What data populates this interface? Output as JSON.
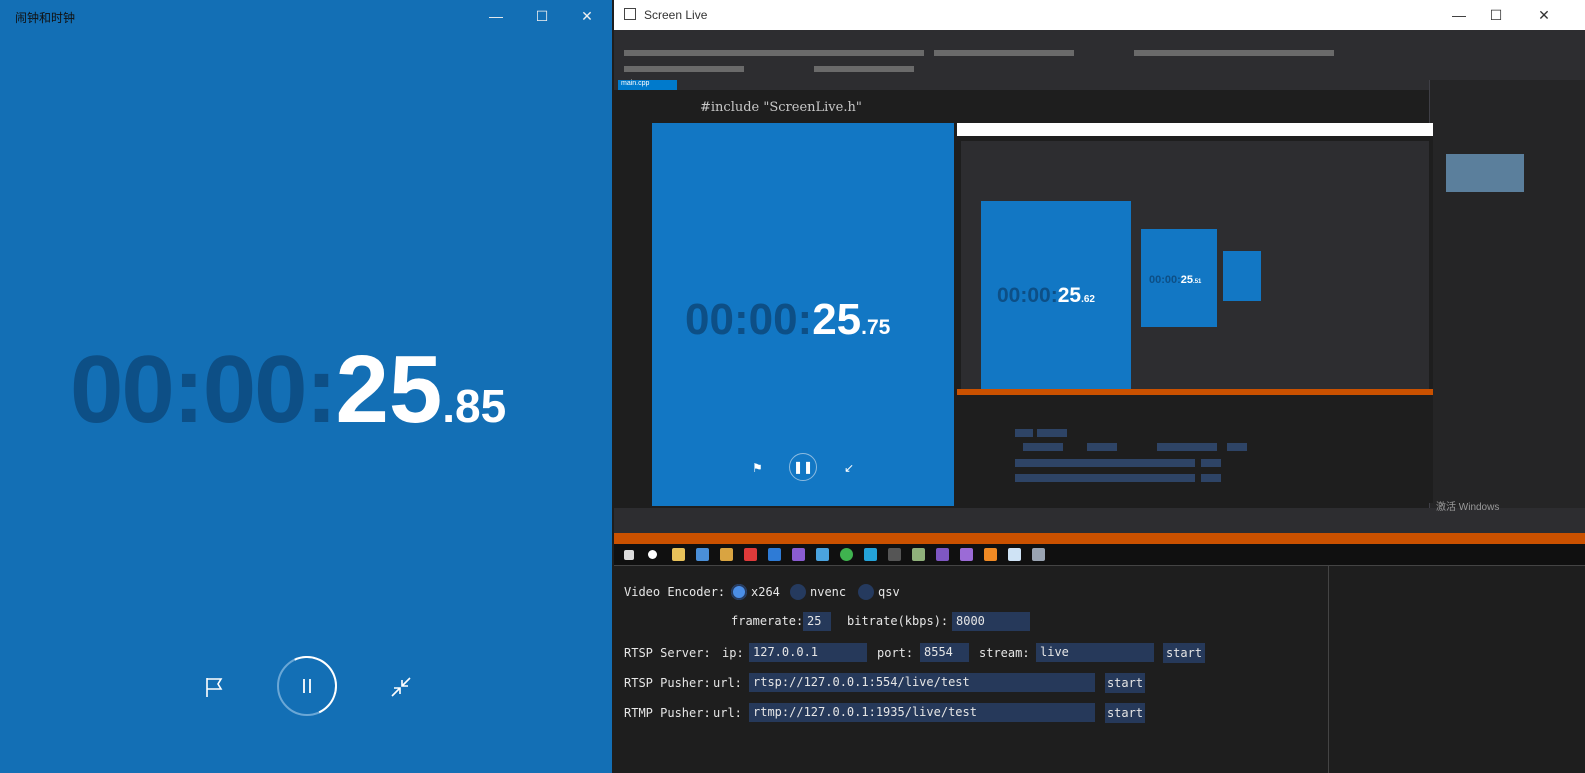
{
  "alarm_app": {
    "title": "闹钟和时钟",
    "timer": {
      "dim": "00:00:",
      "seconds": "25",
      "centis": ".85"
    }
  },
  "live_app": {
    "title": "Screen Live",
    "controls": {
      "video_encoder_label": "Video Encoder:",
      "encoders": [
        "x264",
        "nvenc",
        "qsv"
      ],
      "selected_encoder": "x264",
      "framerate_label": "framerate:",
      "framerate_value": "25",
      "bitrate_label": "bitrate(kbps):",
      "bitrate_value": "8000",
      "rtsp_server_label": "RTSP Server:",
      "ip_label": "ip:",
      "ip_value": "127.0.0.1",
      "port_label": "port:",
      "port_value": "8554",
      "stream_label": "stream:",
      "stream_value": "live",
      "rtsp_pusher_label": "RTSP Pusher:",
      "url_label": "url:",
      "rtsp_url_value": "rtsp://127.0.0.1:554/live/test",
      "rtmp_pusher_label": "RTMP Pusher:",
      "rtmp_url_value": "rtmp://127.0.0.1:1935/live/test",
      "start_label": "start"
    }
  },
  "preview": {
    "tab": "main.cpp",
    "code_line": "#include \"ScreenLive.h\"",
    "nested_timer_1": {
      "dim": "00:00:",
      "seconds": "25",
      "centis": ".75"
    },
    "nested_timer_2": {
      "dim": "00:00:",
      "seconds": "25",
      "centis": ".62"
    },
    "nested_timer_3": {
      "dim": "00:00:",
      "seconds": "25",
      "centis": ".51"
    },
    "watermark": "激活 Windows"
  },
  "colors": {
    "alarm_bg": "#136fb5",
    "dim_digits": "#0d4f86",
    "field_bg": "#26395a",
    "radio_checked": "#4b8ee6",
    "vs_orange": "#ca5100"
  },
  "icons": [
    "minimize-icon",
    "maximize-icon",
    "close-icon",
    "flag-icon",
    "pause-icon",
    "shrink-icon"
  ]
}
